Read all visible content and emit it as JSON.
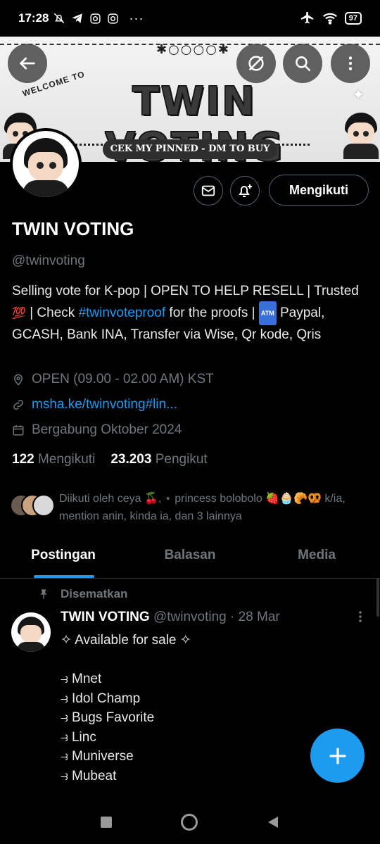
{
  "status_bar": {
    "time": "17:28",
    "battery": "97"
  },
  "banner": {
    "welcome": "WELCOME TO",
    "title": "TWIN VOTING",
    "deco": "✱○○○○✱",
    "pill": "CEK MY PINNED - DM TO BUY"
  },
  "profile": {
    "follow_button": "Mengikuti",
    "display_name": "TWIN VOTING",
    "handle": "@twinvoting",
    "bio": {
      "part1": "Selling vote for K-pop | OPEN TO HELP RESELL | Trusted ",
      "emoji_100": "💯",
      "part2": " | Check ",
      "hashtag": "#twinvoteproof",
      "part3": " for the proofs | ",
      "atm": "ATM",
      "part4": " Paypal,  GCASH, Bank INA, Transfer via Wise, Qr kode, Qris"
    },
    "location": "OPEN (09.00  - 02.00 AM) KST",
    "website": "msha.ke/twinvoting#lin...",
    "joined": "Bergabung Oktober 2024",
    "following_count": "122",
    "following_label": "Mengikuti",
    "followers_count": "23.203",
    "followers_label": "Pengikut",
    "followed_by": "Diikuti oleh ceya 🍒, ⋆ princess bolobolo 🍓🧁🥐🥨 k/ia, mention anin, kinda ia, dan 3 lainnya"
  },
  "tabs": [
    {
      "label": "Postingan",
      "active": true
    },
    {
      "label": "Balasan",
      "active": false
    },
    {
      "label": "Media",
      "active": false
    }
  ],
  "post": {
    "pinned_label": "Disematkan",
    "author": "TWIN VOTING",
    "handle": "@twinvoting",
    "date": "· 28 Mar",
    "lines": [
      "✧ Available for sale ✧",
      "",
      "⥽ Mnet",
      "⥽ Idol Champ",
      "⥽ Bugs Favorite",
      "⥽ Linc",
      "⥽ Muniverse",
      "⥽ Mubeat"
    ]
  },
  "colors": {
    "accent": "#1d9bf0",
    "muted": "#71767b",
    "border": "#536471"
  }
}
